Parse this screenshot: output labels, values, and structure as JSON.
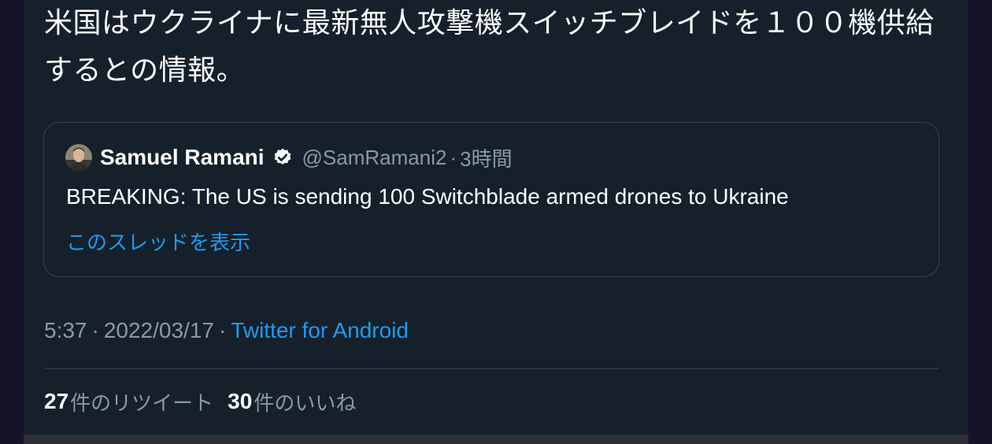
{
  "tweet": {
    "text": "米国はウクライナに最新無人攻撃機スイッチブレイドを１００機供給するとの情報。",
    "quote": {
      "author_name": "Samuel Ramani",
      "handle": "@SamRamani2",
      "separator": "·",
      "time_ago": "3時間",
      "text": "BREAKING: The US is sending 100 Switchblade armed drones to Ukraine",
      "show_thread": "このスレッドを表示",
      "verified_icon": "verified-badge-icon",
      "avatar": "avatar"
    },
    "time": "5:37",
    "separator": "·",
    "date": "2022/03/17",
    "client": "Twitter for Android",
    "retweets": {
      "count": "27",
      "label": "件のリツイート"
    },
    "likes": {
      "count": "30",
      "label": "件のいいね"
    }
  },
  "colors": {
    "background": "#15202b",
    "outer_background": "#161229",
    "accent": "#1d9bf0",
    "secondary_text": "#8b98a5",
    "border": "#38444d"
  }
}
